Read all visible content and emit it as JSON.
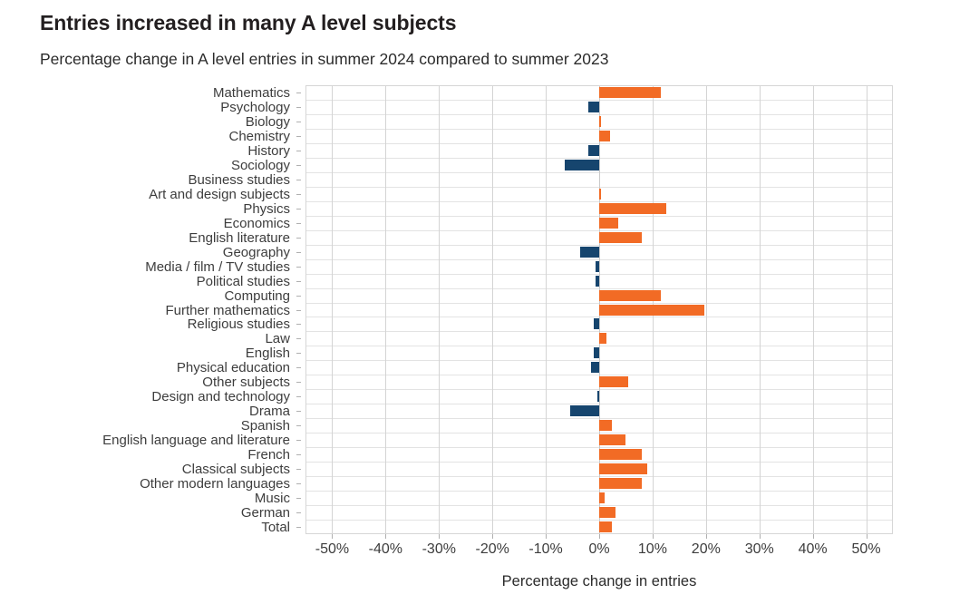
{
  "chart_data": {
    "type": "bar",
    "orientation": "horizontal",
    "title": "Entries increased in many A level subjects",
    "subtitle": "Percentage change in A level entries in summer 2024 compared to summer 2023",
    "xlabel": "Percentage change in entries",
    "ylabel": "",
    "xlim": [
      -55,
      55
    ],
    "xticks": [
      -50,
      -40,
      -30,
      -20,
      -10,
      0,
      10,
      20,
      30,
      40,
      50
    ],
    "xtick_labels": [
      "-50%",
      "-40%",
      "-30%",
      "-20%",
      "-10%",
      "0%",
      "10%",
      "20%",
      "30%",
      "40%",
      "50%"
    ],
    "grid": "both",
    "legend": "none",
    "colors": {
      "positive": "#f26b25",
      "negative": "#16456e",
      "gridline": "#e3e3e3",
      "vertical_gridline": "#d4d4d4",
      "text": "#3d3d3d",
      "title": "#231f20",
      "background": "#ffffff"
    },
    "categories": [
      "Mathematics",
      "Psychology",
      "Biology",
      "Chemistry",
      "History",
      "Sociology",
      "Business studies",
      "Art and design subjects",
      "Physics",
      "Economics",
      "English literature",
      "Geography",
      "Media / film / TV studies",
      "Political studies",
      "Computing",
      "Further mathematics",
      "Religious studies",
      "Law",
      "English",
      "Physical education",
      "Other subjects",
      "Design and technology",
      "Drama",
      "Spanish",
      "English language and literature",
      "French",
      "Classical subjects",
      "Other modern languages",
      "Music",
      "German",
      "Total"
    ],
    "values": [
      11.5,
      -2.0,
      0.3,
      2.0,
      -2.0,
      -6.5,
      0.0,
      0.3,
      12.5,
      3.5,
      8.0,
      -3.5,
      -0.7,
      -0.7,
      11.5,
      19.7,
      -1.0,
      1.3,
      -1.0,
      -1.5,
      5.5,
      -0.3,
      -5.5,
      2.3,
      5.0,
      8.0,
      9.0,
      8.0,
      1.0,
      3.0,
      2.3
    ]
  }
}
